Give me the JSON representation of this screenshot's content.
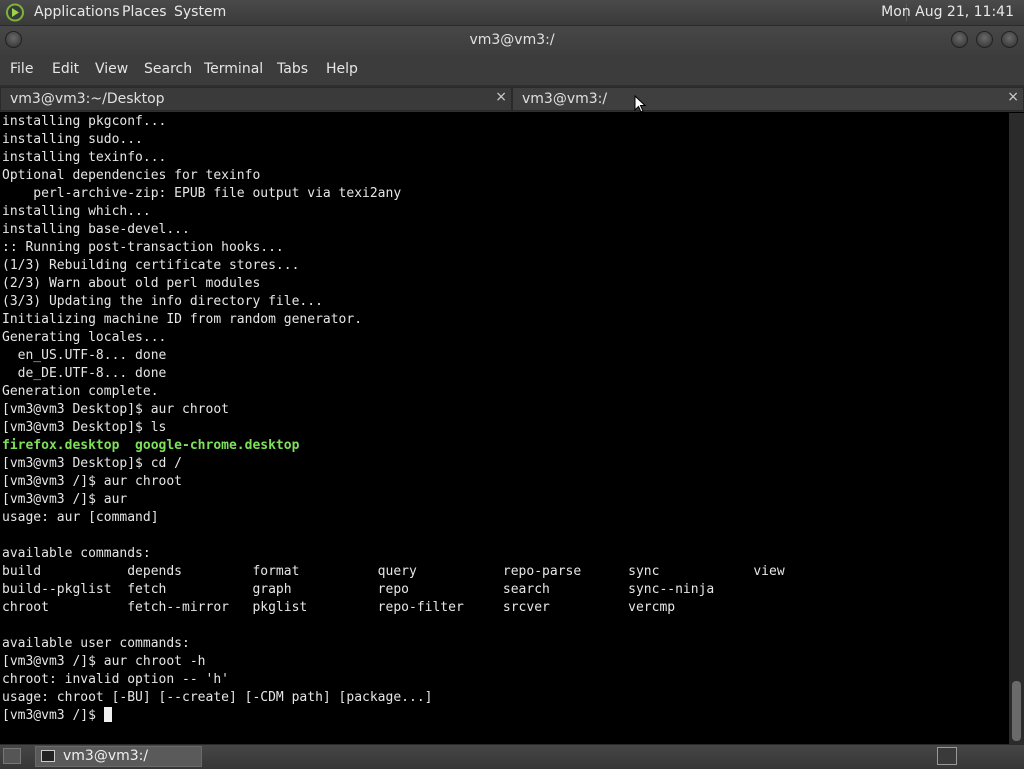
{
  "top_panel": {
    "menus": [
      "Applications",
      "Places",
      "System"
    ],
    "clock": "Mon Aug 21, 11:41"
  },
  "window": {
    "title": "vm3@vm3:/"
  },
  "menubar": [
    "File",
    "Edit",
    "View",
    "Search",
    "Terminal",
    "Tabs",
    "Help"
  ],
  "tabs": [
    {
      "label": "vm3@vm3:~/Desktop",
      "close": "×"
    },
    {
      "label": "vm3@vm3:/",
      "close": "×"
    }
  ],
  "terminal": {
    "lines": [
      "installing pkgconf...",
      "installing sudo...",
      "installing texinfo...",
      "Optional dependencies for texinfo",
      "    perl-archive-zip: EPUB file output via texi2any",
      "installing which...",
      "installing base-devel...",
      ":: Running post-transaction hooks...",
      "(1/3) Rebuilding certificate stores...",
      "(2/3) Warn about old perl modules",
      "(3/3) Updating the info directory file...",
      "Initializing machine ID from random generator.",
      "Generating locales...",
      "  en_US.UTF-8... done",
      "  de_DE.UTF-8... done",
      "Generation complete.",
      "[vm3@vm3 Desktop]$ aur chroot",
      "[vm3@vm3 Desktop]$ ls",
      "firefox.desktop  google-chrome.desktop",
      "[vm3@vm3 Desktop]$ cd /",
      "[vm3@vm3 /]$ aur chroot",
      "[vm3@vm3 /]$ aur",
      "usage: aur [command]",
      "",
      "available commands:",
      "build           depends         format          query           repo-parse      sync            view",
      "build--pkglist  fetch           graph           repo            search          sync--ninja",
      "chroot          fetch--mirror   pkglist         repo-filter     srcver          vercmp",
      "",
      "available user commands:",
      "[vm3@vm3 /]$ aur chroot -h",
      "chroot: invalid option -- 'h'",
      "usage: chroot [-BU] [--create] [-CDM path] [package...]",
      "[vm3@vm3 /]$ "
    ],
    "green_line_index": 18
  },
  "taskbar": {
    "task_label": "vm3@vm3:/"
  }
}
